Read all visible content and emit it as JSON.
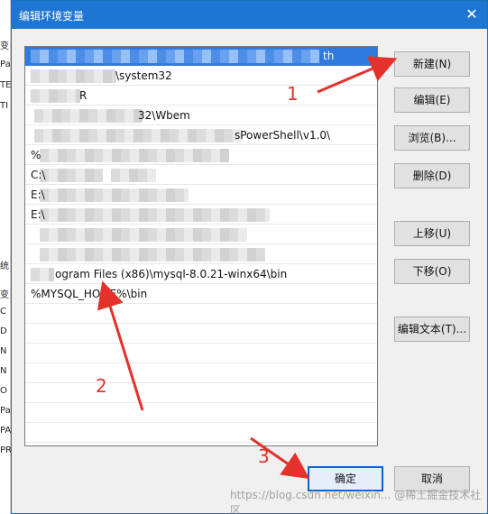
{
  "background_window": {
    "left_labels": [
      "变",
      "Pa",
      "TE",
      "TI",
      "统",
      "变",
      "C",
      "D",
      "N",
      "N",
      "O",
      "Pa",
      "PA",
      "PR"
    ]
  },
  "dialog": {
    "title": "编辑环境变量",
    "close_icon": "close-icon"
  },
  "list": {
    "rows": [
      {
        "visible_tail": "th",
        "selected": true
      },
      {
        "visible_tail": "\\system32",
        "selected": false
      },
      {
        "visible_tail": "R",
        "selected": false
      },
      {
        "visible_tail": "32\\Wbem",
        "selected": false
      },
      {
        "visible_tail": "sPowerShell\\v1.0\\",
        "selected": false
      },
      {
        "visible_tail": "%",
        "selected": false
      },
      {
        "visible_tail": "C:\\",
        "selected": false
      },
      {
        "visible_tail": "E:\\",
        "selected": false
      },
      {
        "visible_tail": "E:\\",
        "selected": false
      },
      {
        "visible_tail": "",
        "selected": false
      },
      {
        "visible_tail": "",
        "selected": false
      },
      {
        "visible_tail": "ogram Files (x86)\\mysql-8.0.21-winx64\\bin",
        "selected": false
      },
      {
        "visible_tail": "%MYSQL_HOME%\\bin",
        "selected": false
      },
      {
        "visible_tail": "",
        "selected": false
      },
      {
        "visible_tail": "",
        "selected": false
      },
      {
        "visible_tail": "",
        "selected": false
      },
      {
        "visible_tail": "",
        "selected": false
      },
      {
        "visible_tail": "",
        "selected": false
      },
      {
        "visible_tail": "",
        "selected": false
      },
      {
        "visible_tail": "",
        "selected": false
      },
      {
        "visible_tail": "",
        "selected": false
      }
    ]
  },
  "buttons": {
    "new": "新建(N)",
    "edit": "编辑(E)",
    "browse": "浏览(B)...",
    "delete": "删除(D)",
    "move_up": "上移(U)",
    "move_down": "下移(O)",
    "edit_text": "编辑文本(T)...",
    "ok": "确定",
    "cancel": "取消"
  },
  "annotations": {
    "label1": "1",
    "label2": "2",
    "label3": "3",
    "color": "#e5312b"
  },
  "watermark": "https://blog.csdn.net/weixin... @稀土掘金技术社区"
}
